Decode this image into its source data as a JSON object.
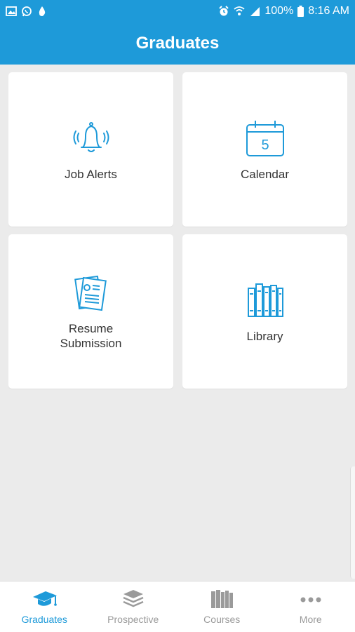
{
  "status_bar": {
    "battery": "100%",
    "time": "8:16 AM",
    "left_icons": [
      "gallery-icon",
      "whatsapp-icon",
      "drop-icon"
    ],
    "right_icons": [
      "alarm-icon",
      "wifi-icon",
      "signal-icon",
      "battery-icon"
    ]
  },
  "header": {
    "title": "Graduates"
  },
  "tiles": [
    {
      "label": "Job Alerts",
      "icon": "bell-icon"
    },
    {
      "label": "Calendar",
      "icon": "calendar-icon",
      "date": "5"
    },
    {
      "label": "Resume Submission",
      "icon": "resume-icon"
    },
    {
      "label": "Library",
      "icon": "books-icon"
    }
  ],
  "bottom_nav": {
    "active": "Graduates",
    "items": [
      {
        "label": "Graduates",
        "icon": "graduation-cap-icon"
      },
      {
        "label": "Prospective",
        "icon": "layers-icon"
      },
      {
        "label": "Courses",
        "icon": "books-icon"
      },
      {
        "label": "More",
        "icon": "more-dots-icon"
      }
    ]
  },
  "colors": {
    "primary": "#1e9ad9",
    "background": "#ebebeb",
    "inactive": "#9a9a9a"
  }
}
